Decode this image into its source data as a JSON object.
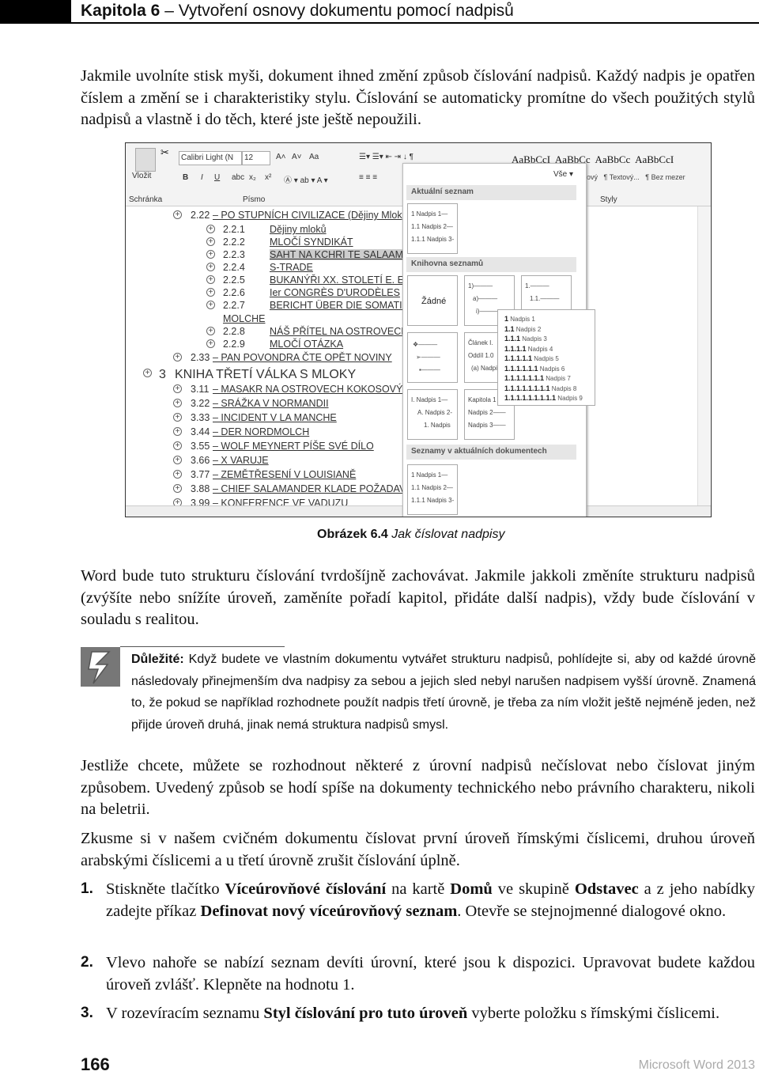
{
  "header": {
    "chapter": "Kapitola 6",
    "title": " – Vytvoření osnovy dokumentu pomocí nadpisů"
  },
  "para1": "Jakmile uvolníte stisk myši, dokument ihned změní způsob číslování nadpisů. Každý nadpis je opatřen číslem a změní se i charakteristiky stylu. Číslování se automaticky promítne do všech použitých stylů nadpisů a vlastně i do těch, které jste ještě nepoužili.",
  "figure": {
    "ribbon": {
      "paste": "Vložit",
      "clipboard": "Schránka",
      "font_name": "Calibri Light (N",
      "font_size": "12",
      "font_group": "Písmo",
      "bold": "B",
      "italic": "I",
      "underline": "U",
      "strike": "abc",
      "sub": "x₂",
      "sup": "x²",
      "grow": "A˄",
      "shrink": "A˅",
      "case": "Aa",
      "styles_group": "Styly",
      "styles": [
        {
          "preview": "AaBbCcI",
          "name": "ový"
        },
        {
          "preview": "AaBbCc",
          "name": "¶ Textový..."
        },
        {
          "preview": "AaBbCc",
          "name": ""
        },
        {
          "preview": "AaBbCcI",
          "name": "¶ Bez mezer"
        }
      ]
    },
    "outline": [
      {
        "level": 2,
        "num": "2.22",
        "text": " – PO STUPNÍCH CIVILIZACE (Dějiny Mlok"
      },
      {
        "level": 3,
        "num": "2.2.1",
        "text": "Dějiny mloků"
      },
      {
        "level": 3,
        "num": "2.2.2",
        "text": "MLOČÍ SYNDIKÁT"
      },
      {
        "level": 3,
        "num": "2.2.3",
        "text": "SAHT NA KCHRI TE SALAAM AI"
      },
      {
        "level": 3,
        "num": "2.2.4",
        "text": "S-TRADE"
      },
      {
        "level": 3,
        "num": "2.2.5",
        "text": "BUKANÝŘI XX. STOLETÍ E. E. K."
      },
      {
        "level": 3,
        "num": "2.2.6",
        "text": "Ier CONGRÈS D'URODÈLES"
      },
      {
        "level": 3,
        "num": "2.2.7",
        "text": "BERICHT ÜBER DIE SOMATISC"
      },
      {
        "level": 0,
        "num": "",
        "text": "MOLCHE"
      },
      {
        "level": 3,
        "num": "2.2.8",
        "text": "NÁŠ PŘÍTEL NA OSTROVECH G"
      },
      {
        "level": 3,
        "num": "2.2.9",
        "text": "MLOČÍ OTÁZKA"
      },
      {
        "level": 2,
        "num": "2.33",
        "text": " – PAN POVONDRA ČTE OPĚT NOVINY"
      },
      {
        "level": 1,
        "num": "3",
        "text": "KNIHA TŘETÍ VÁLKA S MLOKY"
      },
      {
        "level": 2,
        "num": "3.11",
        "text": " – MASAKR NA OSTROVECH KOKOSOVÝCH"
      },
      {
        "level": 2,
        "num": "3.22",
        "text": " – SRÁŽKA V NORMANDII"
      },
      {
        "level": 2,
        "num": "3.33",
        "text": " – INCIDENT V LA MANCHE"
      },
      {
        "level": 2,
        "num": "3.44",
        "text": " – DER NORDMOLCH"
      },
      {
        "level": 2,
        "num": "3.55",
        "text": " – WOLF MEYNERT PÍŠE SVÉ DÍLO"
      },
      {
        "level": 2,
        "num": "3.66",
        "text": " – X VARUJE"
      },
      {
        "level": 2,
        "num": "3.77",
        "text": " – ZEMĚTŘESENÍ V LOUISIANĚ"
      },
      {
        "level": 2,
        "num": "3.88",
        "text": " – CHIEF SALAMANDER KLADE POŽADAVK"
      },
      {
        "level": 2,
        "num": "3.99",
        "text": " – KONFERENCE VE VADUZU"
      }
    ],
    "panel": {
      "all": "Vše ▾",
      "current": "Aktuální seznam",
      "library": "Knihovna seznamů",
      "in_docs": "Seznamy v aktuálních dokumentech",
      "none": "Žádné",
      "current_list": [
        "1 Nadpis 1—",
        "1.1 Nadpis 2—",
        "1.1.1 Nadpis 3-"
      ],
      "list_a": [
        "1)———",
        "a)———",
        "i)———"
      ],
      "list_b": [
        "1.———",
        "1.1.———"
      ],
      "list_bullets": [
        "❖———",
        "➢———",
        "▪———"
      ],
      "list_article": [
        "Článek I.",
        "Oddíl 1.0",
        "(a) Nadpi"
      ],
      "list_roman": [
        "I. Nadpis 1—",
        "A. Nadpis 2-",
        "1. Nadpis"
      ],
      "list_chapter": [
        "Kapitola 1",
        "Nadpis 2——",
        "Nadpis 3——"
      ],
      "doc_list": [
        "1 Nadpis 1—",
        "1.1 Nadpis 2—",
        "1.1.1 Nadpis 3-"
      ]
    },
    "tooltip": [
      {
        "n": "1",
        "t": "Nadpis 1"
      },
      {
        "n": "1.1",
        "t": "Nadpis 2"
      },
      {
        "n": "1.1.1",
        "t": "Nadpis 3"
      },
      {
        "n": "1.1.1.1",
        "t": "Nadpis 4"
      },
      {
        "n": "1.1.1.1.1",
        "t": "Nadpis 5"
      },
      {
        "n": "1.1.1.1.1.1",
        "t": "Nadpis 6"
      },
      {
        "n": "1.1.1.1.1.1.1",
        "t": "Nadpis 7"
      },
      {
        "n": "1.1.1.1.1.1.1.1",
        "t": "Nadpis 8"
      },
      {
        "n": "1.1.1.1.1.1.1.1.1",
        "t": "Nadpis 9"
      }
    ]
  },
  "caption": {
    "label": "Obrázek 6.4",
    "text": " Jak číslovat nadpisy"
  },
  "para2": "Word bude tuto strukturu číslování tvrdošíjně zachovávat. Jakmile jakkoli změníte strukturu nadpisů (zvýšíte nebo snížíte úroveň, zaměníte pořadí kapitol, přidáte další nadpis), vždy bude číslování v souladu s realitou.",
  "note": {
    "label": "Důležité:",
    "text": " Když budete ve vlastním dokumentu vytvářet strukturu nadpisů, pohlídejte si, aby od každé úrovně následovaly přinejmenším dva nadpisy za sebou a jejich sled nebyl narušen nadpisem vyšší úrovně. Znamená to, že pokud se například rozhodnete použít nadpis třetí úrovně, je třeba za ním vložit ještě nejméně jeden, než přijde úroveň druhá, jinak nemá struktura nadpisů smysl.",
    "icon": "warning-lightning-icon"
  },
  "para3": "Jestliže chcete, můžete se rozhodnout některé z úrovní nadpisů nečíslovat nebo číslovat jiným způsobem. Uvedený způsob se hodí spíše na dokumenty technického nebo právního charakteru, nikoli na beletrii.",
  "para4": "Zkusme si v našem cvičném dokumentu číslovat první úroveň římskými číslicemi, druhou úroveň arabskými číslicemi a u třetí úrovně zrušit číslování úplně.",
  "steps": [
    {
      "n": "1.",
      "parts": [
        "Stiskněte tlačítko ",
        "Víceúrovňové číslování",
        " na kartě ",
        "Domů",
        " ve skupině ",
        "Odstavec",
        " a z jeho nabídky zadejte příkaz ",
        "Definovat nový víceúrovňový seznam",
        ". Otevře se stejnojmenné dialogové okno."
      ]
    },
    {
      "n": "2.",
      "parts": [
        "Vlevo nahoře se nabízí seznam devíti úrovní, které jsou k dispozici. Upravovat budete každou úroveň zvlášť. Klepněte na hodnotu 1."
      ]
    },
    {
      "n": "3.",
      "parts": [
        "V rozevíracím seznamu ",
        "Styl číslování pro tuto úroveň",
        " vyberte položku s římskými číslicemi."
      ]
    }
  ],
  "footer": {
    "page": "166",
    "book": "Microsoft Word 2013"
  }
}
